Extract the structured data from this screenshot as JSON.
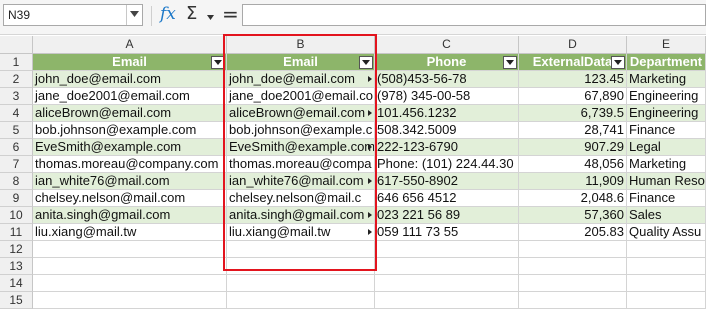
{
  "formula_bar": {
    "name_box": "N39",
    "formula": "",
    "icons": [
      "function-wizard-icon",
      "sum-icon",
      "dropdown-icon",
      "equals-icon"
    ]
  },
  "columns": [
    "A",
    "B",
    "C",
    "D",
    "E"
  ],
  "rows": [
    "1",
    "2",
    "3",
    "4",
    "5",
    "6",
    "7",
    "8",
    "9",
    "10",
    "11",
    "12",
    "13",
    "14",
    "15"
  ],
  "header": {
    "A": "Email",
    "B": "Email",
    "C": "Phone",
    "D": "ExternalData",
    "E": "Department"
  },
  "data": [
    {
      "A": "john_doe@email.com",
      "B": "john_doe@email.com",
      "C": "(508)453-56-78",
      "D": "123.45",
      "E": "Marketing"
    },
    {
      "A": "jane_doe2001@email.com",
      "B": "jane_doe2001@email.co",
      "C": "(978) 345-00-58",
      "D": "67,890",
      "E": "Engineering"
    },
    {
      "A": "aliceBrown@email.com",
      "B": "aliceBrown@email.com",
      "C": "101.456.1232",
      "D": "6,739.5",
      "E": "Engineering"
    },
    {
      "A": "bob.johnson@example.com",
      "B": "bob.johnson@example.c",
      "C": "508.342.5009",
      "D": "28,741",
      "E": "Finance"
    },
    {
      "A": "EveSmith@example.com",
      "B": "EveSmith@example.com",
      "C": "222-123-6790",
      "D": "907.29",
      "E": "Legal"
    },
    {
      "A": "thomas.moreau@company.com",
      "B": "thomas.moreau@compa",
      "C": "Phone: (101) 224.44.30",
      "D": "48,056",
      "E": "Marketing"
    },
    {
      "A": "ian_white76@mail.com",
      "B": "ian_white76@mail.com",
      "C": "617-550-8902",
      "D": "11,909",
      "E": "Human Reso"
    },
    {
      "A": "chelsey.nelson@mail.com",
      "B": "chelsey.nelson@mail.c",
      "C": "646 656 4512",
      "D": "2,048.6",
      "E": "Finance"
    },
    {
      "A": "anita.singh@gmail.com",
      "B": "anita.singh@gmail.com",
      "C": "023 221 56 89",
      "D": "57,360",
      "E": "Sales"
    },
    {
      "A": "liu.xiang@mail.tw",
      "B": "liu.xiang@mail.tw",
      "C": "059 111 73 55",
      "D": "205.83",
      "E": "Quality Assu"
    }
  ],
  "clipped_cells_b": [
    1,
    3,
    5,
    7
  ],
  "colors": {
    "header_bg": "#8db56a",
    "band_bg": "#e2efd9",
    "highlight": "#e3141e",
    "fx": "#1c78c8"
  }
}
